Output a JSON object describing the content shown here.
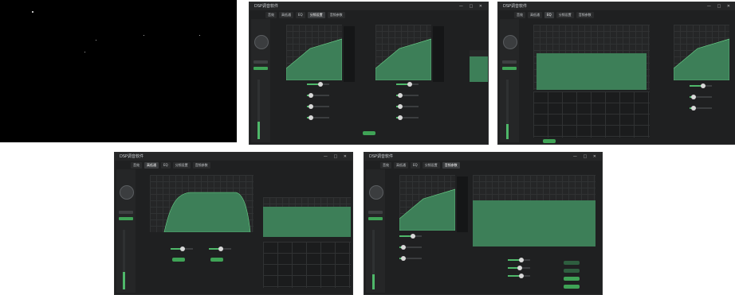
{
  "window": {
    "title": "DSP调音软件"
  },
  "tabs": [
    "音效",
    "高低通",
    "EQ",
    "分频设置",
    "音频参数"
  ],
  "colors": {
    "accent": "#3fa356",
    "fill": "#3d7f58",
    "bg": "#1f2021"
  },
  "icons": {
    "window_controls": "minimize-maximize-close"
  }
}
